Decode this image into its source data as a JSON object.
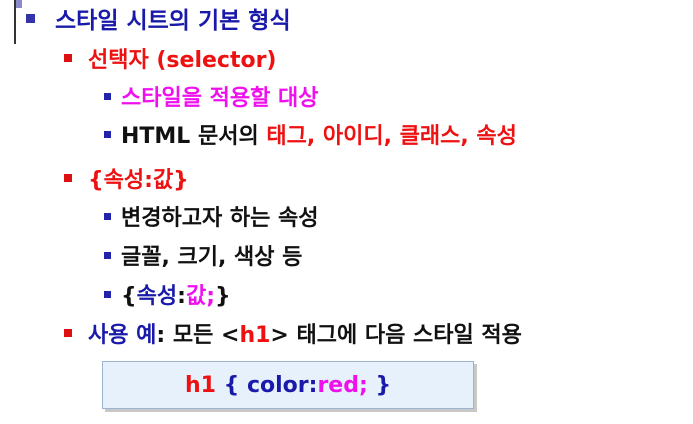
{
  "heading": "스타일 시트의 기본 형식",
  "selector": {
    "title": "선택자 (selector)",
    "item1": "스타일을 적용할 대상",
    "item2_prefix": "HTML 문서의 ",
    "item2_highlight": "태그, 아이디, 클래스, 속성"
  },
  "property": {
    "title": "{속성:값}",
    "item1": "변경하고자 하는 속성",
    "item2": "글꼴, 크기, 색상 등",
    "item3_open": "{",
    "item3_prop": "속성",
    "item3_colon": ":",
    "item3_val": "값;",
    "item3_close": "}"
  },
  "example": {
    "label": "사용 예",
    "colon": ": ",
    "text1": "모든 <",
    "tag": "h1",
    "text2": "> 태그에 다음 스타일 적용"
  },
  "code": {
    "selector": "h1",
    "open": " { ",
    "prop": "color",
    "colon": ":",
    "value": "red;",
    "close": " }"
  }
}
